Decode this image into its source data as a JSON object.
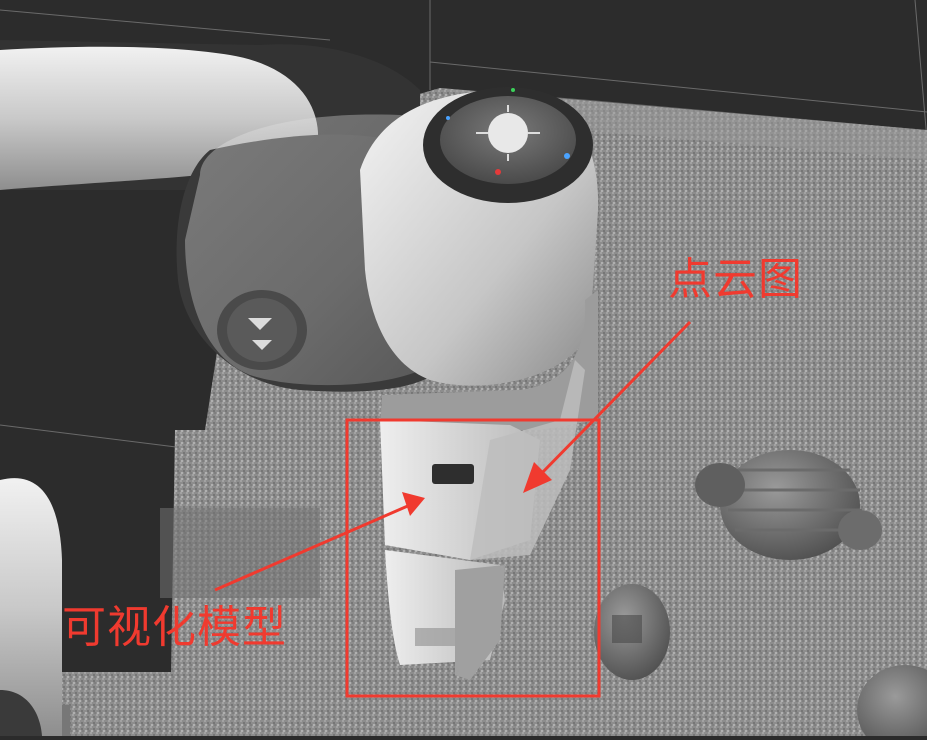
{
  "scene": {
    "background_color": "#2b2b2b",
    "floor_color": "#8f8f8f",
    "robot_color": "#d9d9d9"
  },
  "annotations": {
    "color": "#f03a2f",
    "point_cloud_label": "点云图",
    "model_label": "可视化模型"
  }
}
